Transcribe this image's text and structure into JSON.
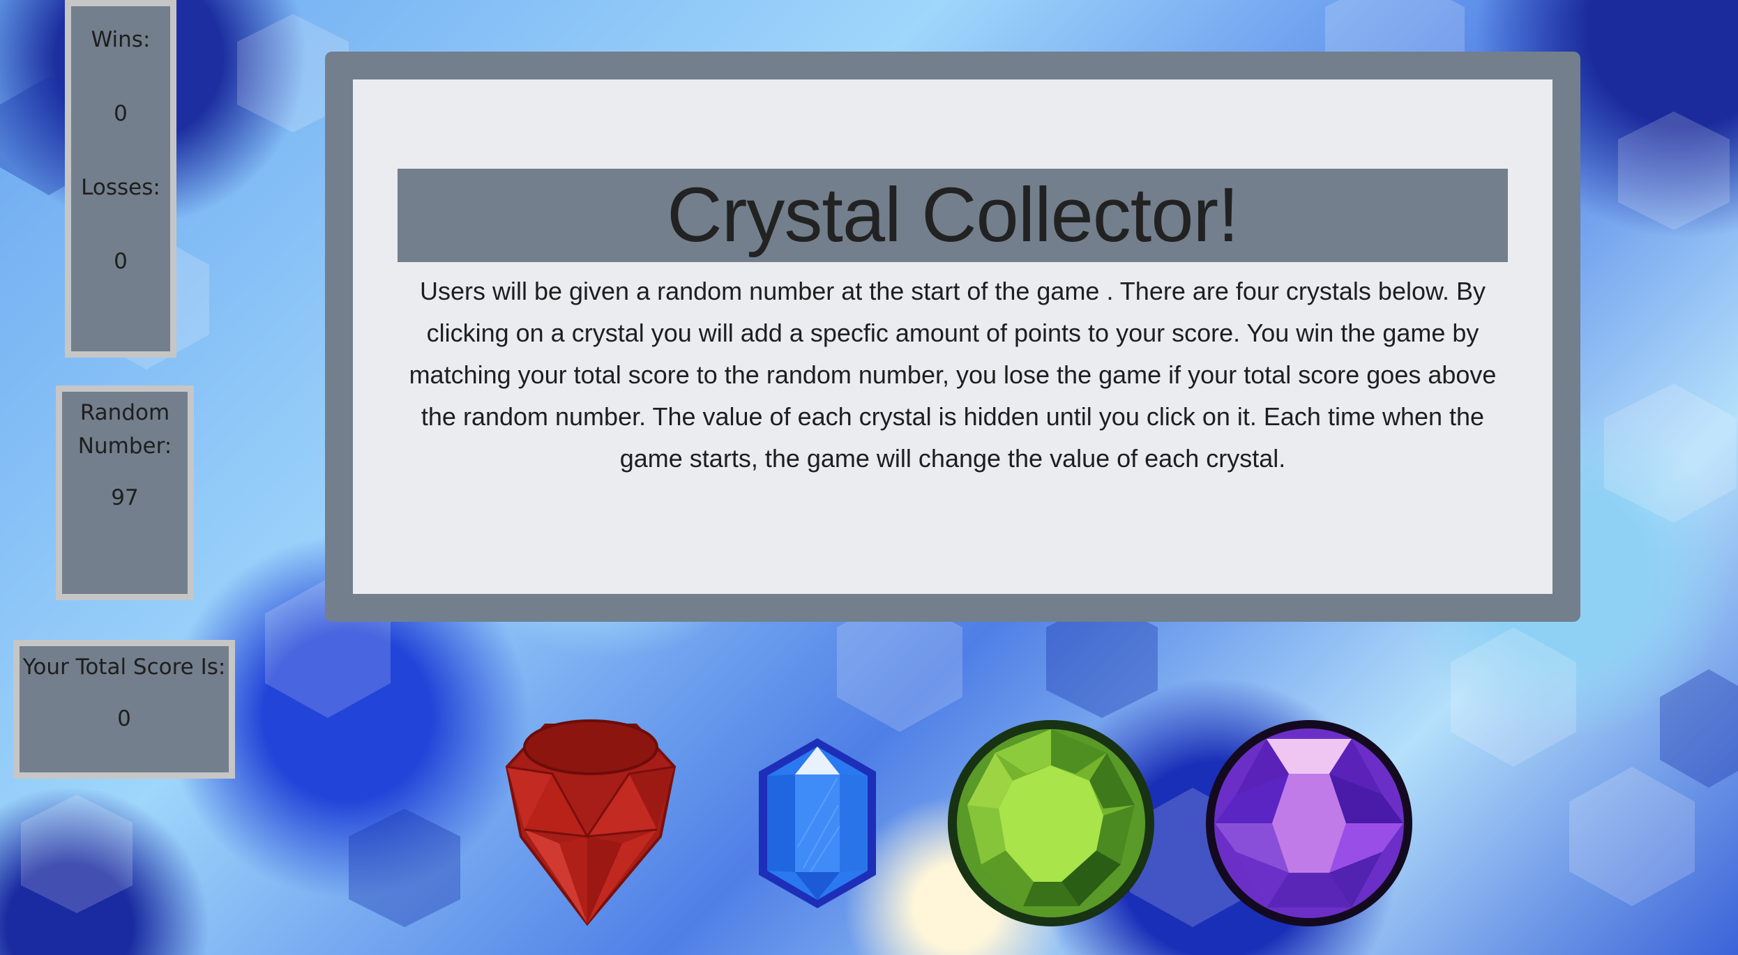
{
  "stats": {
    "wins_label": "Wins:",
    "wins_value": "0",
    "losses_label": "Losses:",
    "losses_value": "0",
    "random_label_line1": "Random",
    "random_label_line2": "Number:",
    "random_value": "97",
    "score_label": "Your Total Score Is:",
    "score_value": "0"
  },
  "info": {
    "title": "Crystal Collector!",
    "description": "Users will be given a random number at the start of the game . There are four crystals below. By clicking on a crystal you will add a specfic amount of points to your score. You win the game by matching your total score to the random number, you lose the game if your total score goes above the random number. The value of each crystal is hidden until you click on it. Each time when the game starts, the game will change the value of each crystal."
  },
  "crystals": [
    {
      "name": "ruby-crystal",
      "color": "#b3241c"
    },
    {
      "name": "sapphire-crystal",
      "color": "#1f6ef0"
    },
    {
      "name": "peridot-crystal",
      "color": "#86c83a"
    },
    {
      "name": "amethyst-crystal",
      "color": "#8a3fe0"
    }
  ],
  "colors": {
    "panel": "#737f8c",
    "panel_inner": "#ebecf0",
    "box_border": "#c6c6c6"
  }
}
